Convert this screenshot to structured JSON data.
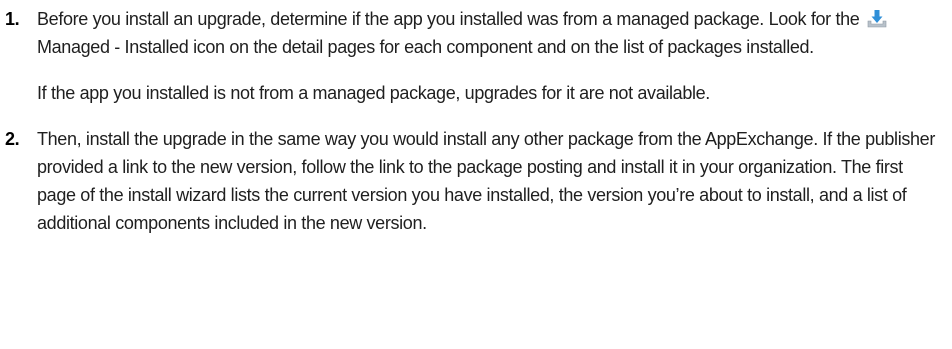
{
  "steps": [
    {
      "number": "1.",
      "p1_before_icon": "Before you install an upgrade, determine if the app you installed was from a managed package. Look for the",
      "icon": "managed-installed-icon",
      "p1_after_icon": "Managed - Installed icon on the detail pages for each component and on the list of packages installed.",
      "p2": "If the app you installed is not from a managed package, upgrades for it are not available."
    },
    {
      "number": "2.",
      "p1": "Then, install the upgrade in the same way you would install any other package from the AppExchange. If the publisher provided a link to the new version, follow the link to the package posting and install it in your organization. The first page of the install wizard lists the current version you have installed, the version you’re about to install, and a list of additional components included in the new version."
    }
  ],
  "colors": {
    "text": "#1f1f1f",
    "icon_arrow": "#2f8fd8",
    "icon_tray": "#b9c2cb"
  }
}
